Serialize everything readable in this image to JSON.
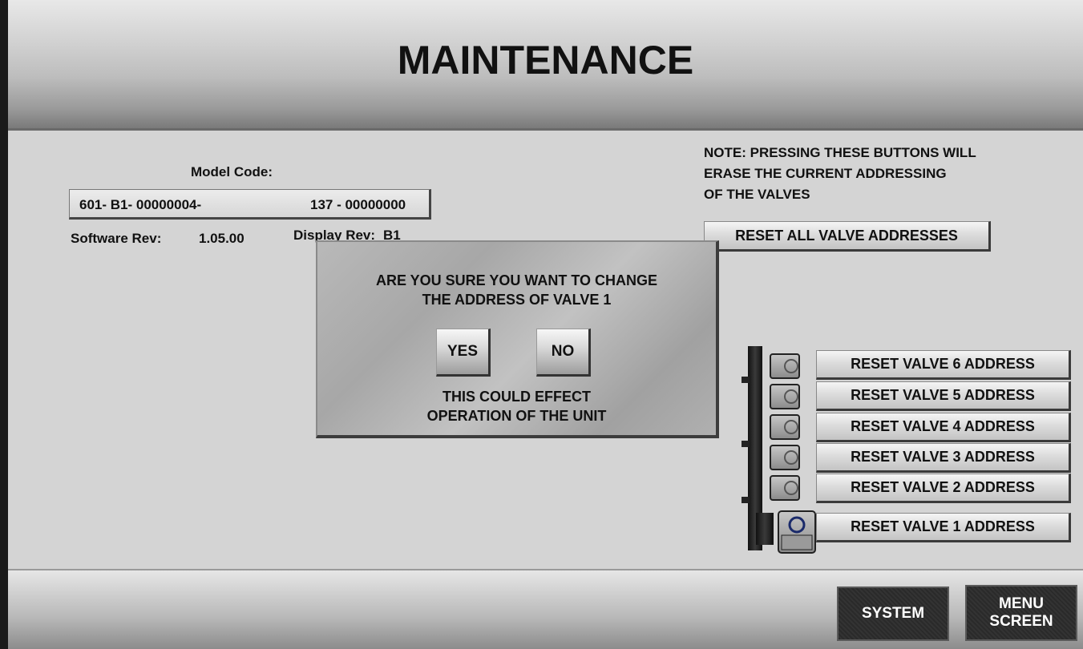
{
  "header": {
    "title": "MAINTENANCE"
  },
  "info": {
    "model_code_label": "Model Code:",
    "model_code_part1": "601- B1- 00000004-",
    "model_code_part2": "137 - 00000000",
    "software_rev_label": "Software Rev:",
    "software_rev_value": "1.05.00",
    "display_rev_label": "Display Rev:",
    "display_rev_value": "B1"
  },
  "note": {
    "line1": "NOTE: PRESSING THESE BUTTONS WILL",
    "line2": "ERASE THE CURRENT ADDRESSING",
    "line3": "OF THE VALVES"
  },
  "buttons": {
    "reset_all": "RESET ALL VALVE ADDRESSES",
    "reset_valves": [
      "RESET VALVE 6 ADDRESS",
      "RESET VALVE 5 ADDRESS",
      "RESET VALVE 4 ADDRESS",
      "RESET VALVE 3 ADDRESS",
      "RESET VALVE 2 ADDRESS",
      "RESET VALVE 1 ADDRESS"
    ]
  },
  "dialog": {
    "line1": "ARE YOU SURE YOU WANT TO CHANGE",
    "line2": "THE ADDRESS OF VALVE 1",
    "yes": "YES",
    "no": "NO",
    "warn1": "THIS COULD EFFECT",
    "warn2": "OPERATION OF THE UNIT"
  },
  "footer": {
    "system": "SYSTEM",
    "menu_line1": "MENU",
    "menu_line2": "SCREEN"
  }
}
